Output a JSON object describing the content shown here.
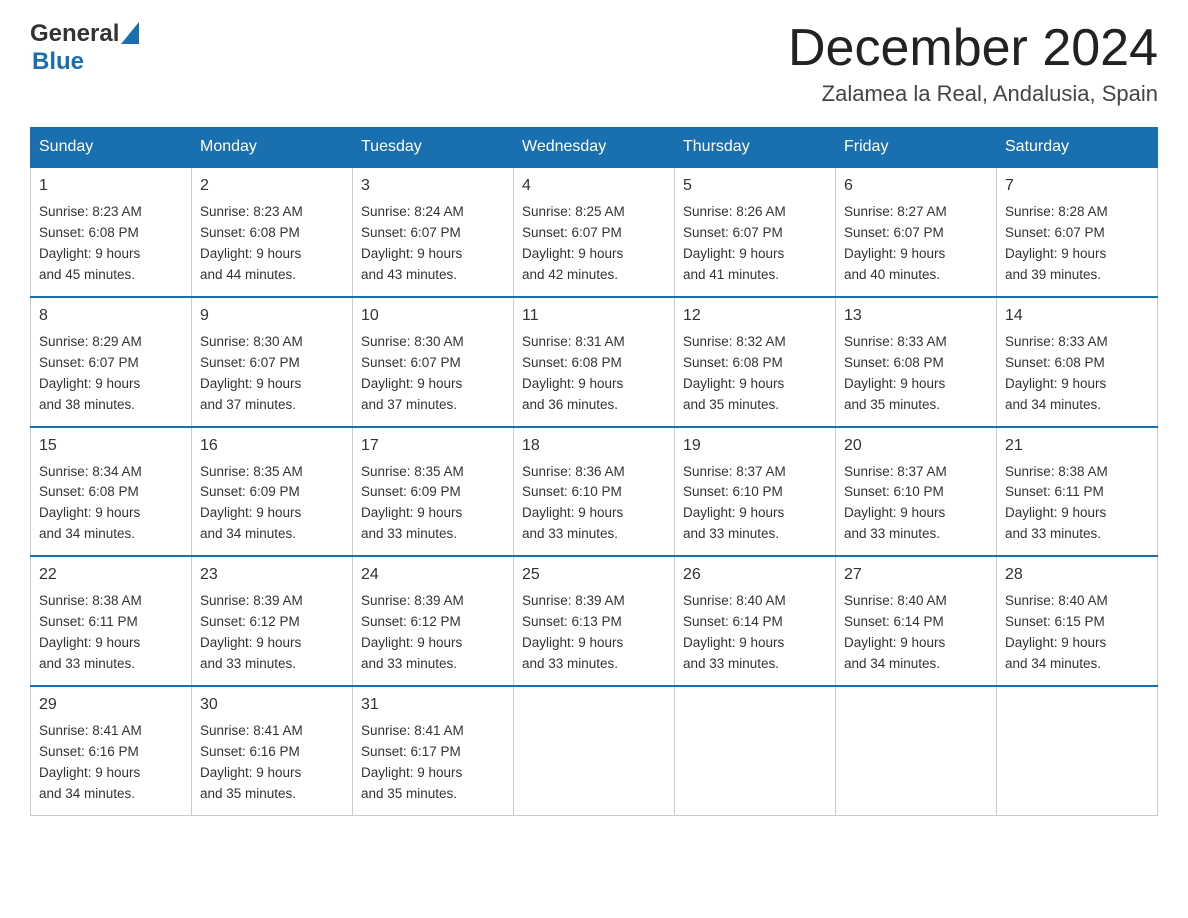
{
  "logo": {
    "general": "General",
    "blue": "Blue"
  },
  "title": {
    "month_year": "December 2024",
    "location": "Zalamea la Real, Andalusia, Spain"
  },
  "headers": [
    "Sunday",
    "Monday",
    "Tuesday",
    "Wednesday",
    "Thursday",
    "Friday",
    "Saturday"
  ],
  "weeks": [
    [
      {
        "day": "1",
        "sunrise": "8:23 AM",
        "sunset": "6:08 PM",
        "daylight": "9 hours and 45 minutes."
      },
      {
        "day": "2",
        "sunrise": "8:23 AM",
        "sunset": "6:08 PM",
        "daylight": "9 hours and 44 minutes."
      },
      {
        "day": "3",
        "sunrise": "8:24 AM",
        "sunset": "6:07 PM",
        "daylight": "9 hours and 43 minutes."
      },
      {
        "day": "4",
        "sunrise": "8:25 AM",
        "sunset": "6:07 PM",
        "daylight": "9 hours and 42 minutes."
      },
      {
        "day": "5",
        "sunrise": "8:26 AM",
        "sunset": "6:07 PM",
        "daylight": "9 hours and 41 minutes."
      },
      {
        "day": "6",
        "sunrise": "8:27 AM",
        "sunset": "6:07 PM",
        "daylight": "9 hours and 40 minutes."
      },
      {
        "day": "7",
        "sunrise": "8:28 AM",
        "sunset": "6:07 PM",
        "daylight": "9 hours and 39 minutes."
      }
    ],
    [
      {
        "day": "8",
        "sunrise": "8:29 AM",
        "sunset": "6:07 PM",
        "daylight": "9 hours and 38 minutes."
      },
      {
        "day": "9",
        "sunrise": "8:30 AM",
        "sunset": "6:07 PM",
        "daylight": "9 hours and 37 minutes."
      },
      {
        "day": "10",
        "sunrise": "8:30 AM",
        "sunset": "6:07 PM",
        "daylight": "9 hours and 37 minutes."
      },
      {
        "day": "11",
        "sunrise": "8:31 AM",
        "sunset": "6:08 PM",
        "daylight": "9 hours and 36 minutes."
      },
      {
        "day": "12",
        "sunrise": "8:32 AM",
        "sunset": "6:08 PM",
        "daylight": "9 hours and 35 minutes."
      },
      {
        "day": "13",
        "sunrise": "8:33 AM",
        "sunset": "6:08 PM",
        "daylight": "9 hours and 35 minutes."
      },
      {
        "day": "14",
        "sunrise": "8:33 AM",
        "sunset": "6:08 PM",
        "daylight": "9 hours and 34 minutes."
      }
    ],
    [
      {
        "day": "15",
        "sunrise": "8:34 AM",
        "sunset": "6:08 PM",
        "daylight": "9 hours and 34 minutes."
      },
      {
        "day": "16",
        "sunrise": "8:35 AM",
        "sunset": "6:09 PM",
        "daylight": "9 hours and 34 minutes."
      },
      {
        "day": "17",
        "sunrise": "8:35 AM",
        "sunset": "6:09 PM",
        "daylight": "9 hours and 33 minutes."
      },
      {
        "day": "18",
        "sunrise": "8:36 AM",
        "sunset": "6:10 PM",
        "daylight": "9 hours and 33 minutes."
      },
      {
        "day": "19",
        "sunrise": "8:37 AM",
        "sunset": "6:10 PM",
        "daylight": "9 hours and 33 minutes."
      },
      {
        "day": "20",
        "sunrise": "8:37 AM",
        "sunset": "6:10 PM",
        "daylight": "9 hours and 33 minutes."
      },
      {
        "day": "21",
        "sunrise": "8:38 AM",
        "sunset": "6:11 PM",
        "daylight": "9 hours and 33 minutes."
      }
    ],
    [
      {
        "day": "22",
        "sunrise": "8:38 AM",
        "sunset": "6:11 PM",
        "daylight": "9 hours and 33 minutes."
      },
      {
        "day": "23",
        "sunrise": "8:39 AM",
        "sunset": "6:12 PM",
        "daylight": "9 hours and 33 minutes."
      },
      {
        "day": "24",
        "sunrise": "8:39 AM",
        "sunset": "6:12 PM",
        "daylight": "9 hours and 33 minutes."
      },
      {
        "day": "25",
        "sunrise": "8:39 AM",
        "sunset": "6:13 PM",
        "daylight": "9 hours and 33 minutes."
      },
      {
        "day": "26",
        "sunrise": "8:40 AM",
        "sunset": "6:14 PM",
        "daylight": "9 hours and 33 minutes."
      },
      {
        "day": "27",
        "sunrise": "8:40 AM",
        "sunset": "6:14 PM",
        "daylight": "9 hours and 34 minutes."
      },
      {
        "day": "28",
        "sunrise": "8:40 AM",
        "sunset": "6:15 PM",
        "daylight": "9 hours and 34 minutes."
      }
    ],
    [
      {
        "day": "29",
        "sunrise": "8:41 AM",
        "sunset": "6:16 PM",
        "daylight": "9 hours and 34 minutes."
      },
      {
        "day": "30",
        "sunrise": "8:41 AM",
        "sunset": "6:16 PM",
        "daylight": "9 hours and 35 minutes."
      },
      {
        "day": "31",
        "sunrise": "8:41 AM",
        "sunset": "6:17 PM",
        "daylight": "9 hours and 35 minutes."
      },
      null,
      null,
      null,
      null
    ]
  ],
  "labels": {
    "sunrise": "Sunrise:",
    "sunset": "Sunset:",
    "daylight": "Daylight:"
  }
}
